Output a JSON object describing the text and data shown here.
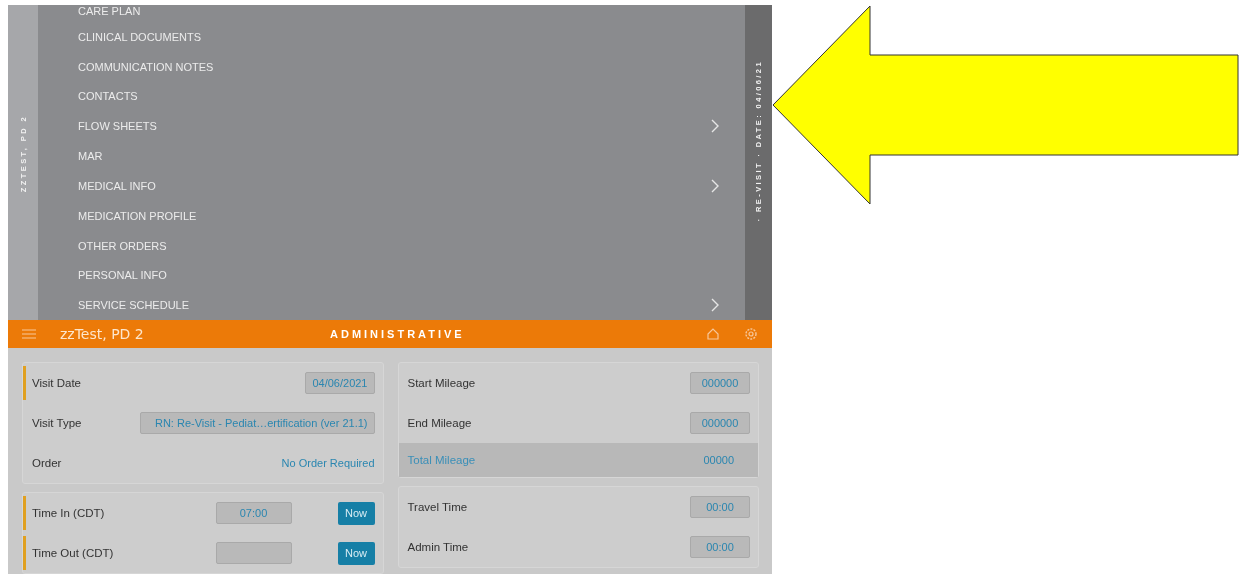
{
  "patient_strip": {
    "label": "ZZTEST, PD 2"
  },
  "menu": [
    {
      "label": "CARE PLAN",
      "has_submenu": false
    },
    {
      "label": "CLINICAL DOCUMENTS",
      "has_submenu": false
    },
    {
      "label": "COMMUNICATION NOTES",
      "has_submenu": false
    },
    {
      "label": "CONTACTS",
      "has_submenu": false
    },
    {
      "label": "FLOW SHEETS",
      "has_submenu": true
    },
    {
      "label": "MAR",
      "has_submenu": false
    },
    {
      "label": "MEDICAL INFO",
      "has_submenu": true
    },
    {
      "label": "MEDICATION PROFILE",
      "has_submenu": false
    },
    {
      "label": "OTHER ORDERS",
      "has_submenu": false
    },
    {
      "label": "PERSONAL INFO",
      "has_submenu": false
    },
    {
      "label": "SERVICE SCHEDULE",
      "has_submenu": true
    }
  ],
  "visit_strip": {
    "label": "· RE-VISIT · DATE: 04/06/21"
  },
  "header": {
    "patient": "zzTest, PD 2",
    "section": "ADMINISTRATIVE"
  },
  "left_cards": [
    [
      {
        "kind": "field",
        "label": "Visit Date",
        "value": "04/06/2021",
        "required": true
      },
      {
        "kind": "wide",
        "label": "Visit Type",
        "value": "RN: Re-Visit - Pediat…ertification (ver 21.1)",
        "required": false
      },
      {
        "kind": "link",
        "label": "Order",
        "value": "No Order Required",
        "required": false
      }
    ],
    [
      {
        "kind": "time",
        "label": "Time In (CDT)",
        "value": "07:00",
        "button": "Now",
        "required": true
      },
      {
        "kind": "time",
        "label": "Time Out (CDT)",
        "button": "Now",
        "required": true
      }
    ]
  ],
  "right_cards": [
    [
      {
        "kind": "field",
        "label": "Start Mileage",
        "value": "000000",
        "required": false
      },
      {
        "kind": "field",
        "label": "End Mileage",
        "value": "000000",
        "required": false
      },
      {
        "kind": "total",
        "label": "Total Mileage",
        "value": "00000",
        "required": false
      }
    ],
    [
      {
        "kind": "field",
        "label": "Travel Time",
        "value": "00:00",
        "required": false
      },
      {
        "kind": "field",
        "label": "Admin Time",
        "value": "00:00",
        "required": false
      }
    ]
  ]
}
